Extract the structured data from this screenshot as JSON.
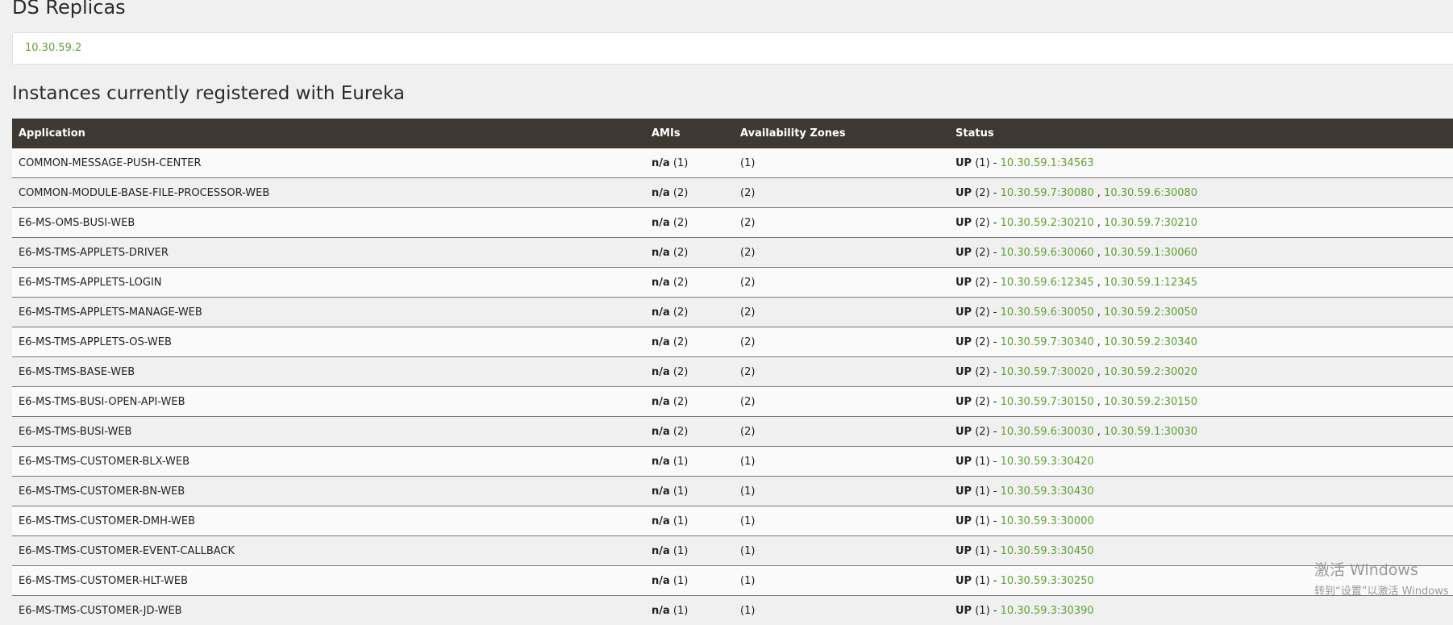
{
  "ds_replicas": {
    "title": "DS Replicas",
    "replica": "10.30.59.2"
  },
  "instances": {
    "title": "Instances currently registered with Eureka",
    "headers": {
      "application": "Application",
      "amis": "AMIs",
      "zones": "Availability Zones",
      "status": "Status"
    },
    "rows": [
      {
        "app": "COMMON-MESSAGE-PUSH-CENTER",
        "ami": "n/a",
        "ami_count": "(1)",
        "zones": "(1)",
        "status": "UP",
        "status_count": "(1) - ",
        "links": [
          "10.30.59.1:34563"
        ]
      },
      {
        "app": "COMMON-MODULE-BASE-FILE-PROCESSOR-WEB",
        "ami": "n/a",
        "ami_count": "(2)",
        "zones": "(2)",
        "status": "UP",
        "status_count": "(2) - ",
        "links": [
          "10.30.59.7:30080",
          "10.30.59.6:30080"
        ]
      },
      {
        "app": "E6-MS-OMS-BUSI-WEB",
        "ami": "n/a",
        "ami_count": "(2)",
        "zones": "(2)",
        "status": "UP",
        "status_count": "(2) - ",
        "links": [
          "10.30.59.2:30210",
          "10.30.59.7:30210"
        ]
      },
      {
        "app": "E6-MS-TMS-APPLETS-DRIVER",
        "ami": "n/a",
        "ami_count": "(2)",
        "zones": "(2)",
        "status": "UP",
        "status_count": "(2) - ",
        "links": [
          "10.30.59.6:30060",
          "10.30.59.1:30060"
        ]
      },
      {
        "app": "E6-MS-TMS-APPLETS-LOGIN",
        "ami": "n/a",
        "ami_count": "(2)",
        "zones": "(2)",
        "status": "UP",
        "status_count": "(2) - ",
        "links": [
          "10.30.59.6:12345",
          "10.30.59.1:12345"
        ]
      },
      {
        "app": "E6-MS-TMS-APPLETS-MANAGE-WEB",
        "ami": "n/a",
        "ami_count": "(2)",
        "zones": "(2)",
        "status": "UP",
        "status_count": "(2) - ",
        "links": [
          "10.30.59.6:30050",
          "10.30.59.2:30050"
        ]
      },
      {
        "app": "E6-MS-TMS-APPLETS-OS-WEB",
        "ami": "n/a",
        "ami_count": "(2)",
        "zones": "(2)",
        "status": "UP",
        "status_count": "(2) - ",
        "links": [
          "10.30.59.7:30340",
          "10.30.59.2:30340"
        ]
      },
      {
        "app": "E6-MS-TMS-BASE-WEB",
        "ami": "n/a",
        "ami_count": "(2)",
        "zones": "(2)",
        "status": "UP",
        "status_count": "(2) - ",
        "links": [
          "10.30.59.7:30020",
          "10.30.59.2:30020"
        ]
      },
      {
        "app": "E6-MS-TMS-BUSI-OPEN-API-WEB",
        "ami": "n/a",
        "ami_count": "(2)",
        "zones": "(2)",
        "status": "UP",
        "status_count": "(2) - ",
        "links": [
          "10.30.59.7:30150",
          "10.30.59.2:30150"
        ]
      },
      {
        "app": "E6-MS-TMS-BUSI-WEB",
        "ami": "n/a",
        "ami_count": "(2)",
        "zones": "(2)",
        "status": "UP",
        "status_count": "(2) - ",
        "links": [
          "10.30.59.6:30030",
          "10.30.59.1:30030"
        ]
      },
      {
        "app": "E6-MS-TMS-CUSTOMER-BLX-WEB",
        "ami": "n/a",
        "ami_count": "(1)",
        "zones": "(1)",
        "status": "UP",
        "status_count": "(1) - ",
        "links": [
          "10.30.59.3:30420"
        ]
      },
      {
        "app": "E6-MS-TMS-CUSTOMER-BN-WEB",
        "ami": "n/a",
        "ami_count": "(1)",
        "zones": "(1)",
        "status": "UP",
        "status_count": "(1) - ",
        "links": [
          "10.30.59.3:30430"
        ]
      },
      {
        "app": "E6-MS-TMS-CUSTOMER-DMH-WEB",
        "ami": "n/a",
        "ami_count": "(1)",
        "zones": "(1)",
        "status": "UP",
        "status_count": "(1) - ",
        "links": [
          "10.30.59.3:30000"
        ]
      },
      {
        "app": "E6-MS-TMS-CUSTOMER-EVENT-CALLBACK",
        "ami": "n/a",
        "ami_count": "(1)",
        "zones": "(1)",
        "status": "UP",
        "status_count": "(1) - ",
        "links": [
          "10.30.59.3:30450"
        ]
      },
      {
        "app": "E6-MS-TMS-CUSTOMER-HLT-WEB",
        "ami": "n/a",
        "ami_count": "(1)",
        "zones": "(1)",
        "status": "UP",
        "status_count": "(1) - ",
        "links": [
          "10.30.59.3:30250"
        ]
      },
      {
        "app": "E6-MS-TMS-CUSTOMER-JD-WEB",
        "ami": "n/a",
        "ami_count": "(1)",
        "zones": "(1)",
        "status": "UP",
        "status_count": "(1) - ",
        "links": [
          "10.30.59.3:30390"
        ]
      }
    ]
  },
  "watermark": {
    "line1": "激活 Windows",
    "line2": "转到“设置”以激活 Windows"
  },
  "colors": {
    "link": "#5fa134",
    "header_bg": "#3d3832",
    "page_bg": "#f0f0f0"
  }
}
